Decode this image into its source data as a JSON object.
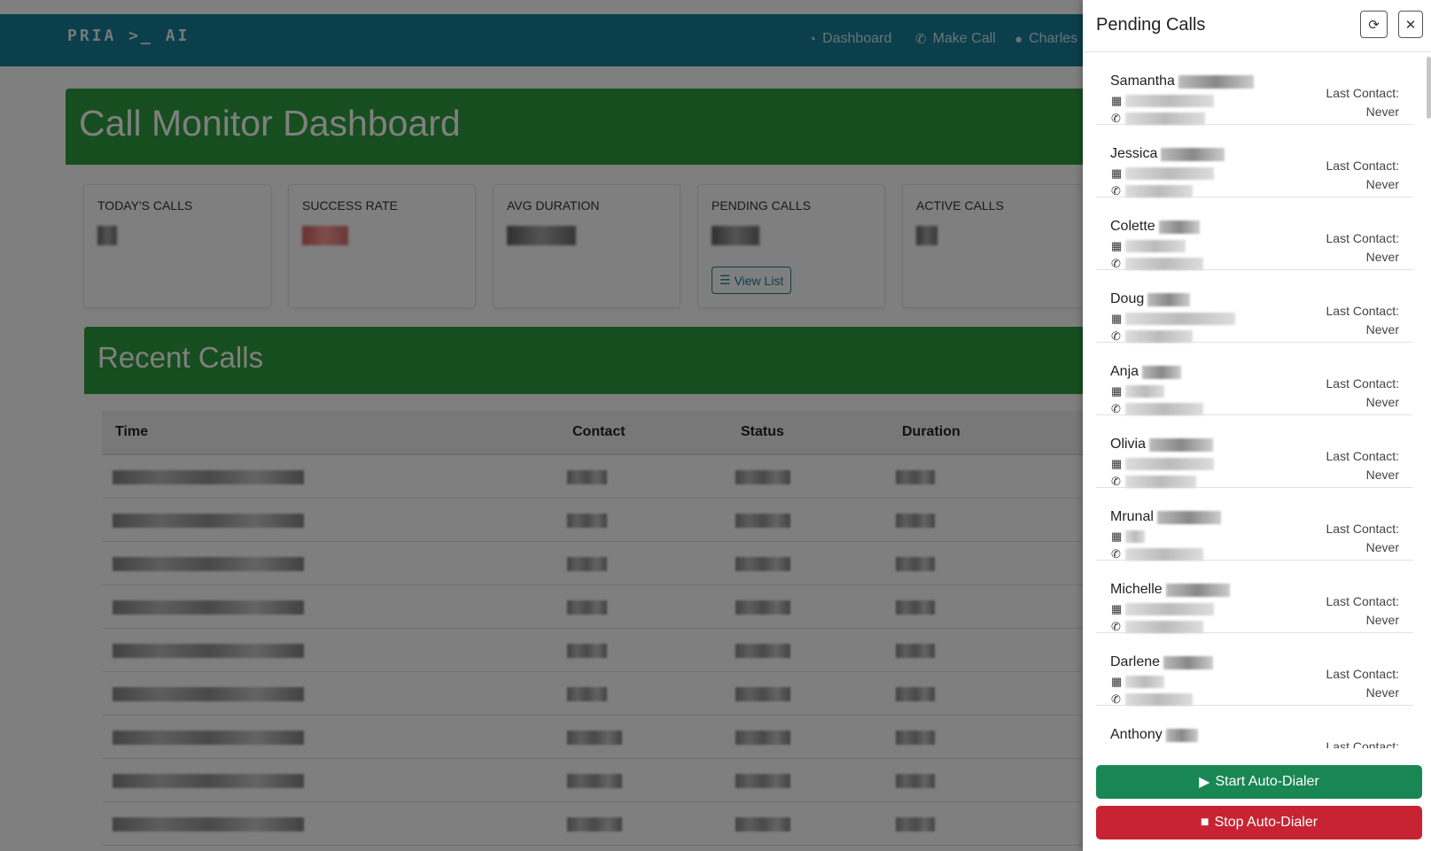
{
  "app": {
    "brand": "PRIA >_ AI",
    "nav": [
      {
        "label": "Dashboard",
        "icon": "dashboard-gauge-icon"
      },
      {
        "label": "Make Call",
        "icon": "phone-icon"
      },
      {
        "label": "Charles",
        "icon": "user-circle-icon"
      }
    ]
  },
  "dashboard": {
    "title": "Call Monitor Dashboard",
    "stats": [
      {
        "label": "TODAY'S CALLS"
      },
      {
        "label": "SUCCESS RATE"
      },
      {
        "label": "AVG DURATION"
      },
      {
        "label": "PENDING CALLS",
        "action": "View List"
      },
      {
        "label": "ACTIVE CALLS"
      }
    ]
  },
  "recent_calls": {
    "title": "Recent Calls",
    "columns": [
      "Time",
      "Contact",
      "Status",
      "Duration"
    ]
  },
  "panel": {
    "title": "Pending Calls",
    "refresh_icon": "refresh-icon",
    "close_icon": "close-icon",
    "last_contact_label": "Last Contact:",
    "contacts": [
      {
        "first_name": "Samantha",
        "last_contact": "Never"
      },
      {
        "first_name": "Jessica",
        "last_contact": "Never"
      },
      {
        "first_name": "Colette",
        "last_contact": "Never"
      },
      {
        "first_name": "Doug",
        "last_contact": "Never"
      },
      {
        "first_name": "Anja",
        "last_contact": "Never"
      },
      {
        "first_name": "Olivia",
        "last_contact": "Never"
      },
      {
        "first_name": "Mrunal",
        "last_contact": "Never"
      },
      {
        "first_name": "Michelle",
        "last_contact": "Never"
      },
      {
        "first_name": "Darlene",
        "last_contact": "Never"
      },
      {
        "first_name": "Anthony",
        "last_contact": ""
      }
    ],
    "start_label": "Start Auto-Dialer",
    "stop_label": "Stop Auto-Dialer"
  },
  "colors": {
    "navbar": "#167f97",
    "hero_green": "#2e9d3e",
    "start_green": "#198754",
    "stop_red": "#c82333"
  }
}
